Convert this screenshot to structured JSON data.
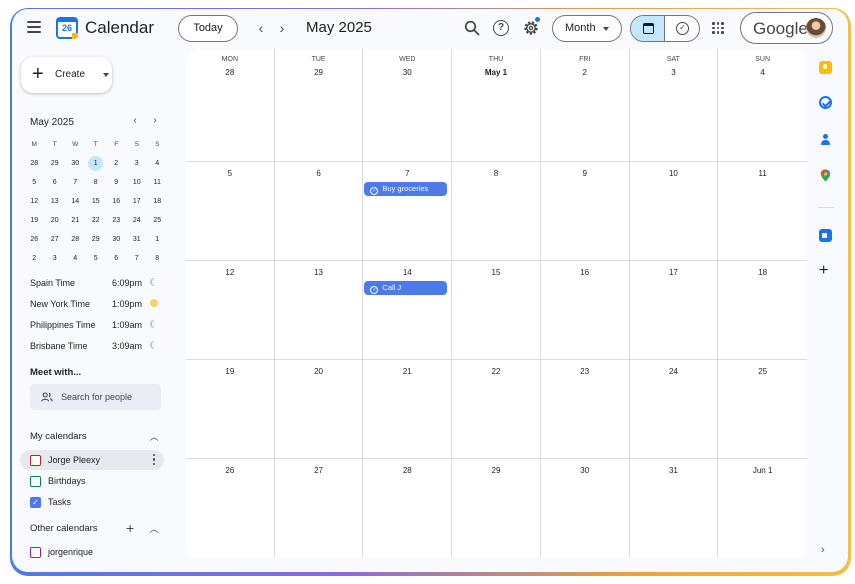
{
  "header": {
    "app_title": "Calendar",
    "logo_day": "26",
    "today_label": "Today",
    "prev_glyph": "‹",
    "next_glyph": "›",
    "month_title": "May 2025",
    "view_label": "Month",
    "account_wordmark": "Google",
    "notification_color": "#1a73e8"
  },
  "sidebar": {
    "create_label": "Create",
    "mini_calendar": {
      "title": "May 2025",
      "weekdays": [
        "M",
        "T",
        "W",
        "T",
        "F",
        "S",
        "S"
      ],
      "weeks": [
        [
          "28",
          "29",
          "30",
          "1",
          "2",
          "3",
          "4"
        ],
        [
          "5",
          "6",
          "7",
          "8",
          "9",
          "10",
          "11"
        ],
        [
          "12",
          "13",
          "14",
          "15",
          "16",
          "17",
          "18"
        ],
        [
          "19",
          "20",
          "21",
          "22",
          "23",
          "24",
          "25"
        ],
        [
          "26",
          "27",
          "28",
          "29",
          "30",
          "31",
          "1"
        ],
        [
          "2",
          "3",
          "4",
          "5",
          "6",
          "7",
          "8"
        ]
      ],
      "selected": "1"
    },
    "clocks": [
      {
        "city": "Spain Time",
        "time": "6:09pm",
        "icon": "moon-icon"
      },
      {
        "city": "New York Time",
        "time": "1:09pm",
        "icon": "sun-icon"
      },
      {
        "city": "Philippines Time",
        "time": "1:09am",
        "icon": "moon-icon"
      },
      {
        "city": "Brisbane Time",
        "time": "3:09am",
        "icon": "moon-icon"
      }
    ],
    "meet_title": "Meet with...",
    "people_search_placeholder": "Search for people",
    "my_calendars_title": "My calendars",
    "my_calendars": [
      {
        "name": "Jorge Pleexy",
        "color": "#b3261e",
        "checked": false
      },
      {
        "name": "Birthdays",
        "color": "#0b8043",
        "checked": false
      },
      {
        "name": "Tasks",
        "color": "#4c7be8",
        "checked": true
      }
    ],
    "other_calendars_title": "Other calendars",
    "other_calendars": [
      {
        "name": "jorgenrique",
        "color": "#8e24aa",
        "checked": false
      }
    ]
  },
  "month_grid": {
    "weekdays": [
      "MON",
      "TUE",
      "WED",
      "THU",
      "FRI",
      "SAT",
      "SUN"
    ],
    "weeks": [
      [
        "28",
        "29",
        "30",
        "May 1",
        "2",
        "3",
        "4"
      ],
      [
        "5",
        "6",
        "7",
        "8",
        "9",
        "10",
        "11"
      ],
      [
        "12",
        "13",
        "14",
        "15",
        "16",
        "17",
        "18"
      ],
      [
        "19",
        "20",
        "21",
        "22",
        "23",
        "24",
        "25"
      ],
      [
        "26",
        "27",
        "28",
        "29",
        "30",
        "31",
        "Jun 1"
      ]
    ],
    "events": [
      {
        "week": 1,
        "day": 2,
        "title": "Buy groceries",
        "color": "#4c7be8"
      },
      {
        "week": 2,
        "day": 2,
        "title": "Call J",
        "color": "#4c7be8"
      }
    ]
  }
}
